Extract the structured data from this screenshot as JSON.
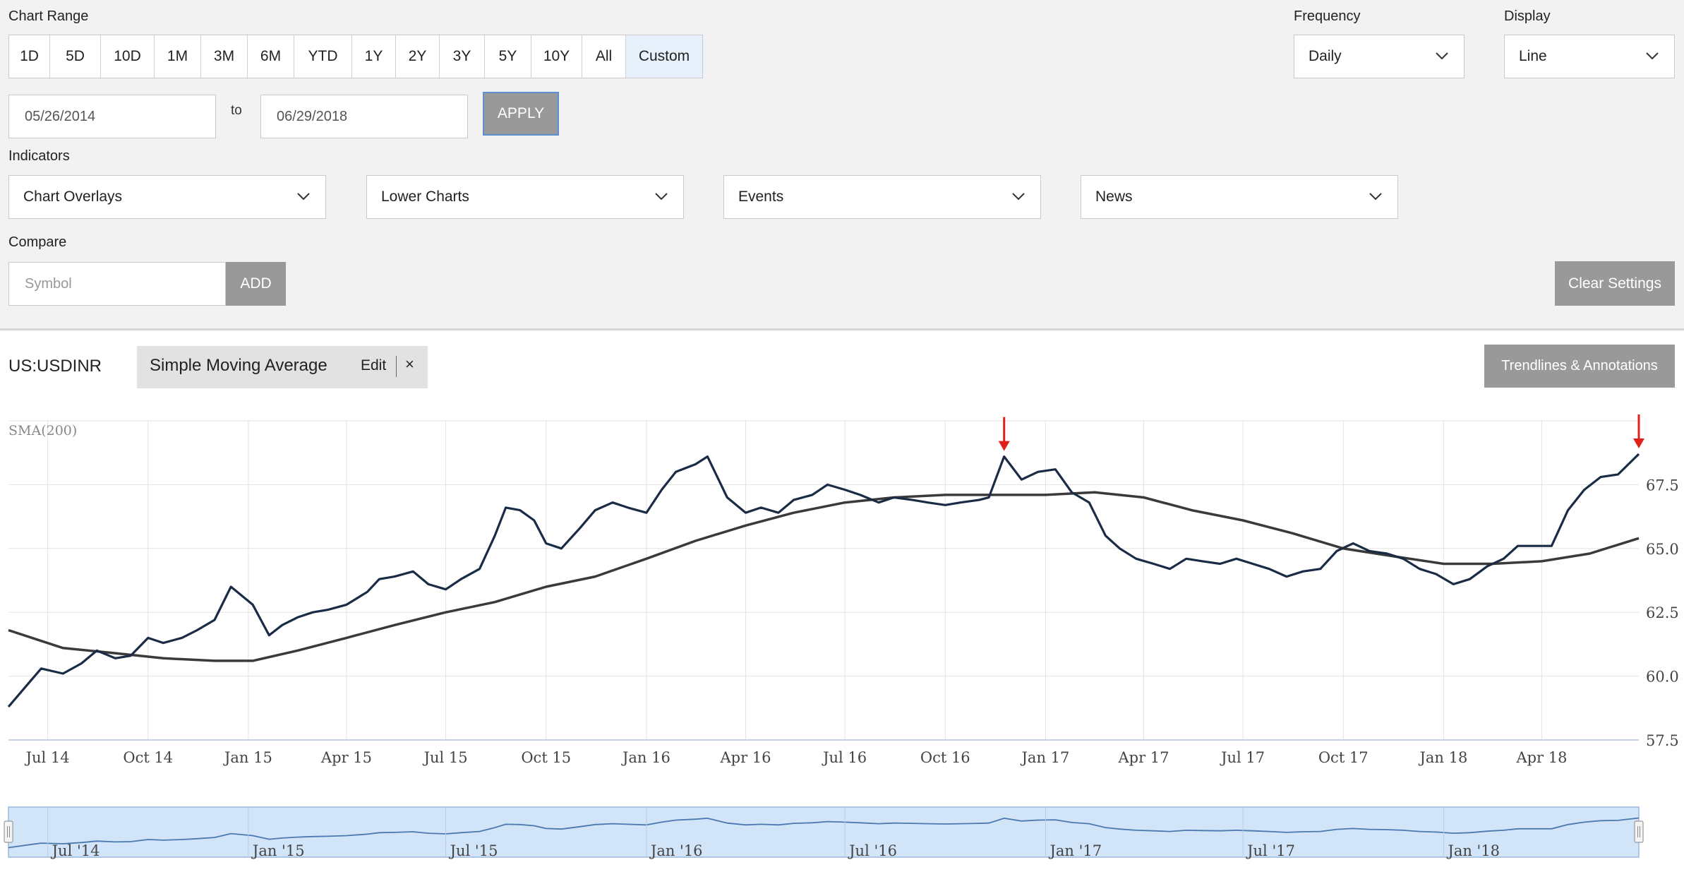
{
  "controls": {
    "chart_range_label": "Chart Range",
    "range_buttons": [
      "1D",
      "5D",
      "10D",
      "1M",
      "3M",
      "6M",
      "YTD",
      "1Y",
      "2Y",
      "3Y",
      "5Y",
      "10Y",
      "All",
      "Custom"
    ],
    "active_range": "Custom",
    "date_from": "05/26/2014",
    "to_label": "to",
    "date_to": "06/29/2018",
    "apply_label": "APPLY",
    "frequency_label": "Frequency",
    "frequency_value": "Daily",
    "display_label": "Display",
    "display_value": "Line",
    "indicators_label": "Indicators",
    "indicator_dropdowns": [
      "Chart Overlays",
      "Lower Charts",
      "Events",
      "News"
    ],
    "compare_label": "Compare",
    "symbol_placeholder": "Symbol",
    "add_label": "ADD",
    "clear_label": "Clear Settings"
  },
  "chart_header": {
    "symbol": "US:USDINR",
    "overlay_name": "Simple Moving Average",
    "edit_label": "Edit",
    "close_label": "×",
    "trendlines_label": "Trendlines & Annotations"
  },
  "colors": {
    "price_line": "#1a2b45",
    "sma_line": "#3a3a3a",
    "grid": "#e3e3e3",
    "navigator_fill": "#d2e4f7",
    "navigator_line": "#4a78b0",
    "arrow": "#e0201b",
    "active_range_bg": "#e6f1fb"
  },
  "chart_data": {
    "type": "line",
    "sma_label": "SMA(200)",
    "x_ticks": [
      "Jul 14",
      "Oct 14",
      "Jan 15",
      "Apr 15",
      "Jul 15",
      "Oct 15",
      "Jan 16",
      "Apr 16",
      "Jul 16",
      "Oct 16",
      "Jan 17",
      "Apr 17",
      "Jul 17",
      "Oct 17",
      "Jan 18",
      "Apr 18"
    ],
    "y_ticks": [
      57.5,
      60.0,
      62.5,
      65.0,
      67.5
    ],
    "y_tick_labels": [
      "57.5",
      "60.0",
      "62.5",
      "65.0",
      "67.5"
    ],
    "ylim": [
      57.5,
      70.0
    ],
    "xlim": [
      "2014-05-26",
      "2018-06-29"
    ],
    "navigator_ticks": [
      "Jul '14",
      "Jan '15",
      "Jul '15",
      "Jan '16",
      "Jul '16",
      "Jan '17",
      "Jul '17",
      "Jan '18"
    ],
    "series": [
      {
        "name": "US:USDINR",
        "x": [
          "2014-05-26",
          "2014-06-15",
          "2014-06-25",
          "2014-07-15",
          "2014-08-01",
          "2014-08-15",
          "2014-09-01",
          "2014-09-15",
          "2014-10-01",
          "2014-10-15",
          "2014-11-01",
          "2014-11-15",
          "2014-12-01",
          "2014-12-16",
          "2015-01-05",
          "2015-01-20",
          "2015-02-01",
          "2015-02-15",
          "2015-03-01",
          "2015-03-15",
          "2015-04-01",
          "2015-04-20",
          "2015-05-01",
          "2015-05-15",
          "2015-06-01",
          "2015-06-15",
          "2015-07-01",
          "2015-07-15",
          "2015-08-01",
          "2015-08-15",
          "2015-08-25",
          "2015-09-07",
          "2015-09-20",
          "2015-10-01",
          "2015-10-15",
          "2015-11-01",
          "2015-11-15",
          "2015-12-01",
          "2015-12-15",
          "2016-01-01",
          "2016-01-15",
          "2016-01-28",
          "2016-02-15",
          "2016-02-26",
          "2016-03-15",
          "2016-04-01",
          "2016-04-15",
          "2016-05-01",
          "2016-05-15",
          "2016-06-01",
          "2016-06-15",
          "2016-07-01",
          "2016-07-15",
          "2016-08-01",
          "2016-08-15",
          "2016-09-01",
          "2016-09-15",
          "2016-10-01",
          "2016-10-15",
          "2016-11-01",
          "2016-11-10",
          "2016-11-24",
          "2016-12-10",
          "2016-12-25",
          "2017-01-10",
          "2017-01-25",
          "2017-02-10",
          "2017-02-25",
          "2017-03-10",
          "2017-03-25",
          "2017-04-10",
          "2017-04-25",
          "2017-05-10",
          "2017-05-25",
          "2017-06-10",
          "2017-06-25",
          "2017-07-10",
          "2017-07-25",
          "2017-08-10",
          "2017-08-25",
          "2017-09-10",
          "2017-09-25",
          "2017-10-10",
          "2017-10-25",
          "2017-11-10",
          "2017-11-25",
          "2017-12-10",
          "2017-12-25",
          "2018-01-10",
          "2018-01-25",
          "2018-02-10",
          "2018-02-25",
          "2018-03-10",
          "2018-03-25",
          "2018-04-10",
          "2018-04-25",
          "2018-05-10",
          "2018-05-25",
          "2018-06-10",
          "2018-06-29"
        ],
        "values": [
          58.8,
          59.8,
          60.3,
          60.1,
          60.5,
          61.0,
          60.7,
          60.8,
          61.5,
          61.3,
          61.5,
          61.8,
          62.2,
          63.5,
          62.8,
          61.6,
          62.0,
          62.3,
          62.5,
          62.6,
          62.8,
          63.3,
          63.8,
          63.9,
          64.1,
          63.6,
          63.4,
          63.8,
          64.2,
          65.5,
          66.6,
          66.5,
          66.1,
          65.2,
          65.0,
          65.8,
          66.5,
          66.8,
          66.6,
          66.4,
          67.3,
          68.0,
          68.3,
          68.6,
          67.0,
          66.4,
          66.6,
          66.4,
          66.9,
          67.1,
          67.5,
          67.3,
          67.1,
          66.8,
          67.0,
          66.9,
          66.8,
          66.7,
          66.8,
          66.9,
          67.0,
          68.6,
          67.7,
          68.0,
          68.1,
          67.2,
          66.8,
          65.5,
          65.0,
          64.6,
          64.4,
          64.2,
          64.6,
          64.5,
          64.4,
          64.6,
          64.4,
          64.2,
          63.9,
          64.1,
          64.2,
          64.9,
          65.2,
          64.9,
          64.8,
          64.6,
          64.2,
          64.0,
          63.6,
          63.8,
          64.3,
          64.6,
          65.1,
          65.1,
          65.1,
          66.5,
          67.3,
          67.8,
          67.9,
          68.7
        ]
      },
      {
        "name": "SMA(200)",
        "x": [
          "2014-05-26",
          "2014-07-15",
          "2014-09-01",
          "2014-10-15",
          "2014-12-01",
          "2015-01-05",
          "2015-02-15",
          "2015-04-01",
          "2015-05-15",
          "2015-07-01",
          "2015-08-15",
          "2015-10-01",
          "2015-11-15",
          "2016-01-01",
          "2016-02-15",
          "2016-04-01",
          "2016-05-15",
          "2016-07-01",
          "2016-08-15",
          "2016-10-01",
          "2016-11-15",
          "2017-01-01",
          "2017-02-15",
          "2017-04-01",
          "2017-05-15",
          "2017-07-01",
          "2017-08-15",
          "2017-10-01",
          "2017-11-15",
          "2018-01-01",
          "2018-02-15",
          "2018-04-01",
          "2018-05-15",
          "2018-06-29"
        ],
        "values": [
          61.8,
          61.1,
          60.9,
          60.7,
          60.6,
          60.6,
          61.0,
          61.5,
          62.0,
          62.5,
          62.9,
          63.5,
          63.9,
          64.6,
          65.3,
          65.9,
          66.4,
          66.8,
          67.0,
          67.1,
          67.1,
          67.1,
          67.2,
          67.0,
          66.5,
          66.1,
          65.6,
          65.0,
          64.7,
          64.4,
          64.4,
          64.5,
          64.8,
          65.4
        ]
      }
    ],
    "annotations": [
      {
        "type": "arrow",
        "x": "2016-11-24",
        "y": 68.6
      },
      {
        "type": "arrow",
        "x": "2018-06-29",
        "y": 68.7
      }
    ]
  }
}
